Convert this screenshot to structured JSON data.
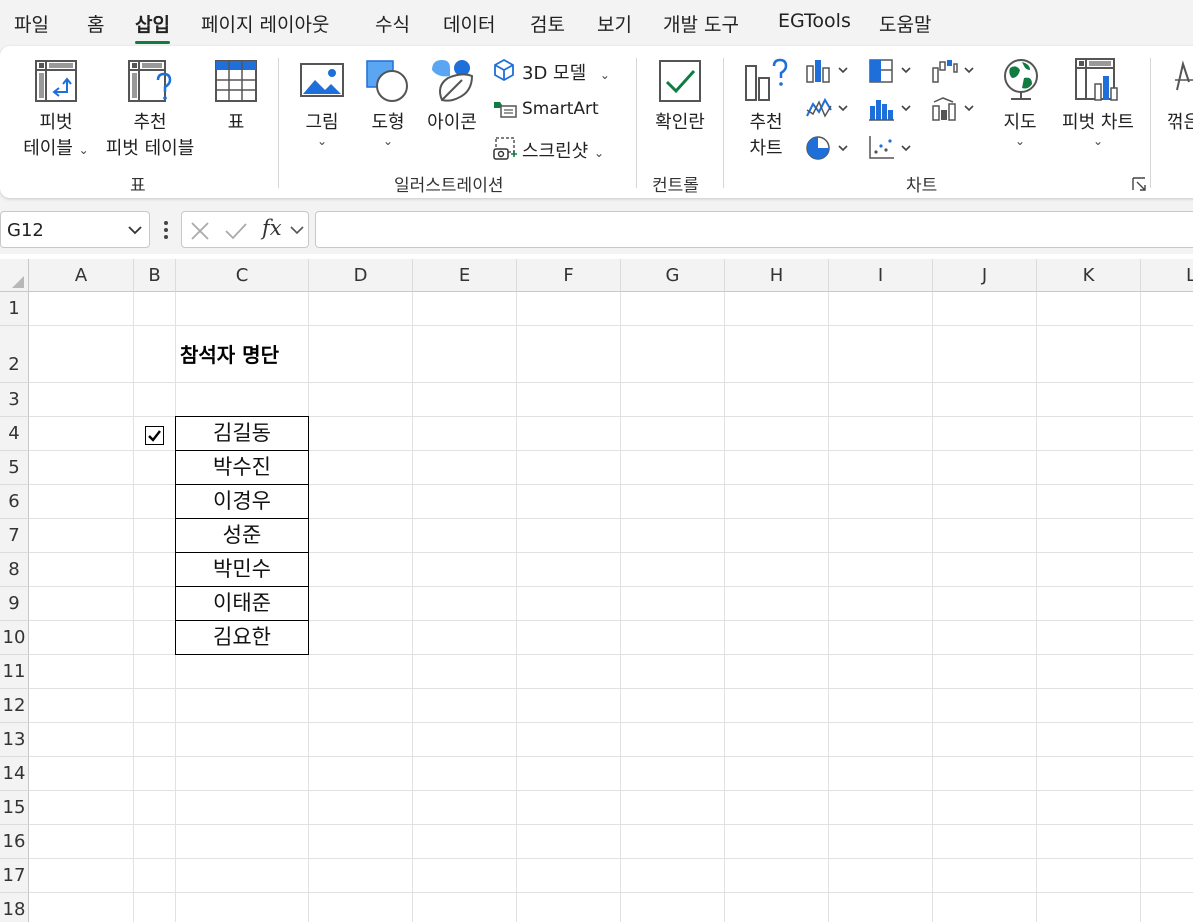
{
  "menu": {
    "tabs": [
      "파일",
      "홈",
      "삽입",
      "페이지 레이아웃",
      "수식",
      "데이터",
      "검토",
      "보기",
      "개발 도구",
      "EGTools",
      "도움말"
    ],
    "active_tab": "삽입"
  },
  "ribbon": {
    "table_group": {
      "label": "표",
      "pivot_table": {
        "line1": "피벗",
        "line2": "테이블"
      },
      "recommended_pivot": {
        "line1": "추천",
        "line2": "피벗 테이블"
      },
      "table": "표"
    },
    "illustrations_group": {
      "label": "일러스트레이션",
      "picture": "그림",
      "shapes": "도형",
      "icons": "아이콘",
      "model3d": "3D 모델",
      "smartart": "SmartArt",
      "screenshot": "스크린샷"
    },
    "controls_group": {
      "label": "컨트롤",
      "checkbox": "확인란"
    },
    "charts_group": {
      "label": "차트",
      "recommended_charts": {
        "line1": "추천",
        "line2": "차트"
      },
      "maps": "지도",
      "pivot_chart": "피벗 차트"
    },
    "cutoff_label": "꺾은"
  },
  "formula_bar": {
    "name_box": "G12",
    "fx": "fx",
    "formula": ""
  },
  "sheet": {
    "columns": [
      "A",
      "B",
      "C",
      "D",
      "E",
      "F",
      "G",
      "H",
      "I",
      "J",
      "K",
      "L"
    ],
    "rows": [
      "1",
      "2",
      "3",
      "4",
      "5",
      "6",
      "7",
      "8",
      "9",
      "10",
      "11",
      "12",
      "13",
      "14",
      "15",
      "16",
      "17",
      "18"
    ],
    "title": "참석자 명단",
    "names": [
      "김길동",
      "박수진",
      "이경우",
      "성준",
      "박민수",
      "이태준",
      "김요한"
    ],
    "checkbox_checked": true
  }
}
